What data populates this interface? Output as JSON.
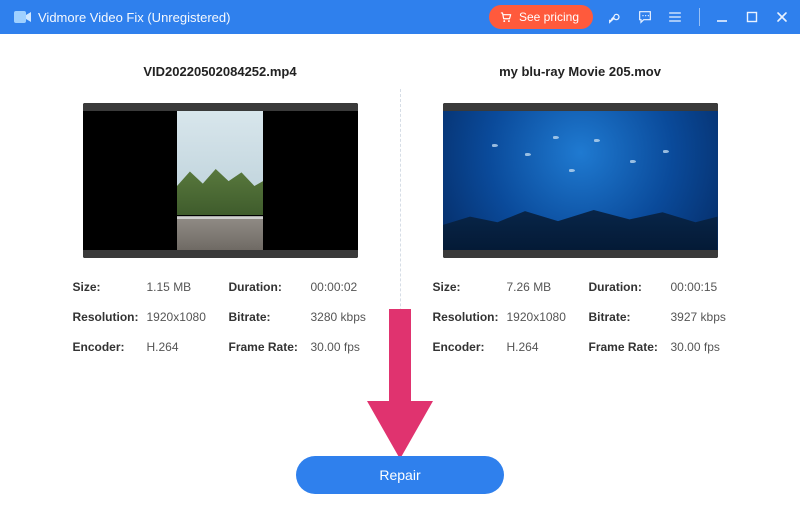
{
  "titlebar": {
    "app_name": "Vidmore Video Fix (Unregistered)",
    "pricing_label": "See pricing"
  },
  "left": {
    "file_name": "VID20220502084252.mp4",
    "size_label": "Size:",
    "size_value": "1.15 MB",
    "duration_label": "Duration:",
    "duration_value": "00:00:02",
    "resolution_label": "Resolution:",
    "resolution_value": "1920x1080",
    "bitrate_label": "Bitrate:",
    "bitrate_value": "3280 kbps",
    "encoder_label": "Encoder:",
    "encoder_value": "H.264",
    "framerate_label": "Frame Rate:",
    "framerate_value": "30.00 fps"
  },
  "right": {
    "file_name": "my blu-ray Movie 205.mov",
    "size_label": "Size:",
    "size_value": "7.26 MB",
    "duration_label": "Duration:",
    "duration_value": "00:00:15",
    "resolution_label": "Resolution:",
    "resolution_value": "1920x1080",
    "bitrate_label": "Bitrate:",
    "bitrate_value": "3927 kbps",
    "encoder_label": "Encoder:",
    "encoder_value": "H.264",
    "framerate_label": "Frame Rate:",
    "framerate_value": "30.00 fps"
  },
  "actions": {
    "repair_label": "Repair"
  },
  "colors": {
    "brand": "#2f80ed",
    "accent": "#ff5a3c",
    "annotation": "#e0336f"
  }
}
